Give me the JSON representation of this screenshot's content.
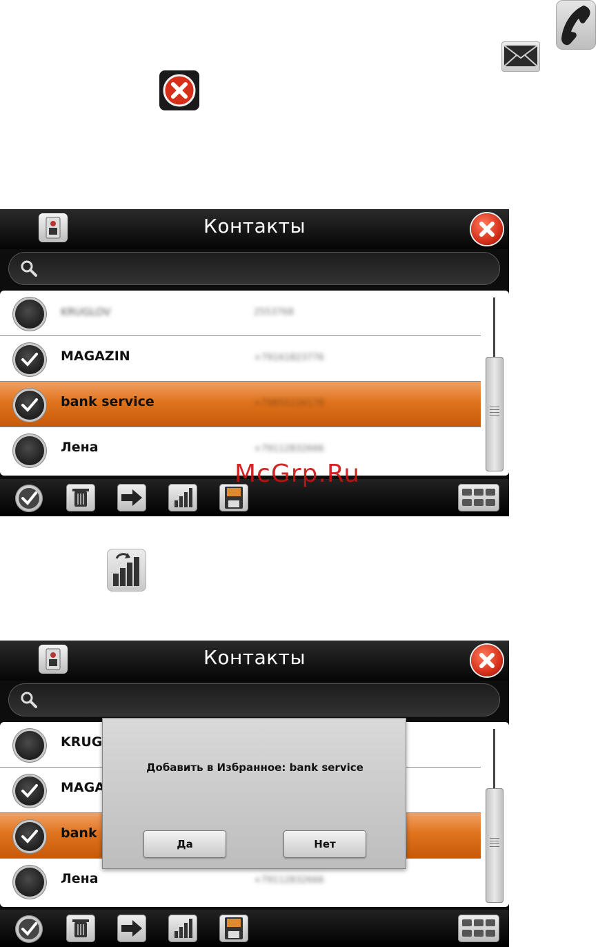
{
  "watermark": "McGrp.Ru",
  "screen1": {
    "title": "Контакты",
    "contacts": [
      {
        "name": "KRUGLOV",
        "blurred": true,
        "checked": false
      },
      {
        "name": "MAGAZIN",
        "blurred": false,
        "checked": true
      },
      {
        "name": "bank service",
        "blurred": false,
        "checked": true,
        "selected": true
      },
      {
        "name": "Лена",
        "blurred": false,
        "checked": false
      }
    ]
  },
  "screen2": {
    "title": "Контакты",
    "contacts": [
      {
        "name": "KRUGI",
        "checked": false
      },
      {
        "name": "MAGA",
        "checked": true
      },
      {
        "name": "bank s",
        "checked": true,
        "selected": true
      },
      {
        "name": "Лена",
        "checked": false
      }
    ],
    "dialog": {
      "message": "Добавить в Избранное: bank service",
      "yes_label": "Да",
      "no_label": "Нет"
    }
  },
  "icons": {
    "top": [
      "phone-icon",
      "envelope-icon",
      "close-icon"
    ],
    "toolbar": [
      "check-all-icon",
      "trash-icon",
      "arrow-right-icon",
      "signal-bars-icon",
      "sim-save-icon",
      "keyboard-icon"
    ]
  },
  "colors": {
    "selection": "#e0731d",
    "close_red": "#d6301a",
    "watermark": "#cc1010"
  }
}
